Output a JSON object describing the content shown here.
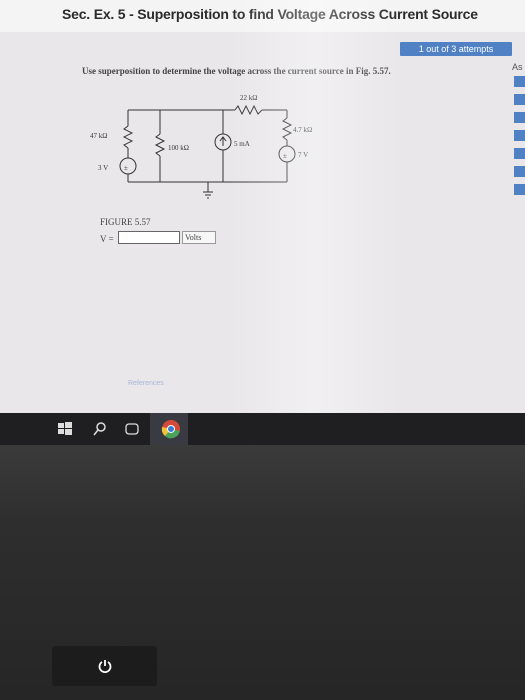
{
  "page": {
    "title": "Sec. Ex. 5 - Superposition to find Voltage Across Current Source",
    "attempts": "1 out of 3 attempts",
    "side_label": "As"
  },
  "question": {
    "text": "Use superposition to determine the voltage across the current source in Fig. 5.57."
  },
  "circuit": {
    "r_left": "47 kΩ",
    "r_top": "22 kΩ",
    "r_mid": "100 kΩ",
    "r_right": "4.7 kΩ",
    "source_left": "3 V",
    "current_source": "5 mA",
    "source_right": "7 V"
  },
  "figure": {
    "label": "FIGURE 5.57",
    "answer_label": "V =",
    "answer_value": "",
    "units": "Volts"
  },
  "footer": {
    "references": "References"
  },
  "taskbar": {
    "items": [
      "windows-start",
      "search",
      "task-view",
      "chrome"
    ]
  },
  "colors": {
    "accent": "#4f81c4",
    "screen_bg": "#e9e7ea",
    "taskbar_bg": "#1f1f22"
  }
}
